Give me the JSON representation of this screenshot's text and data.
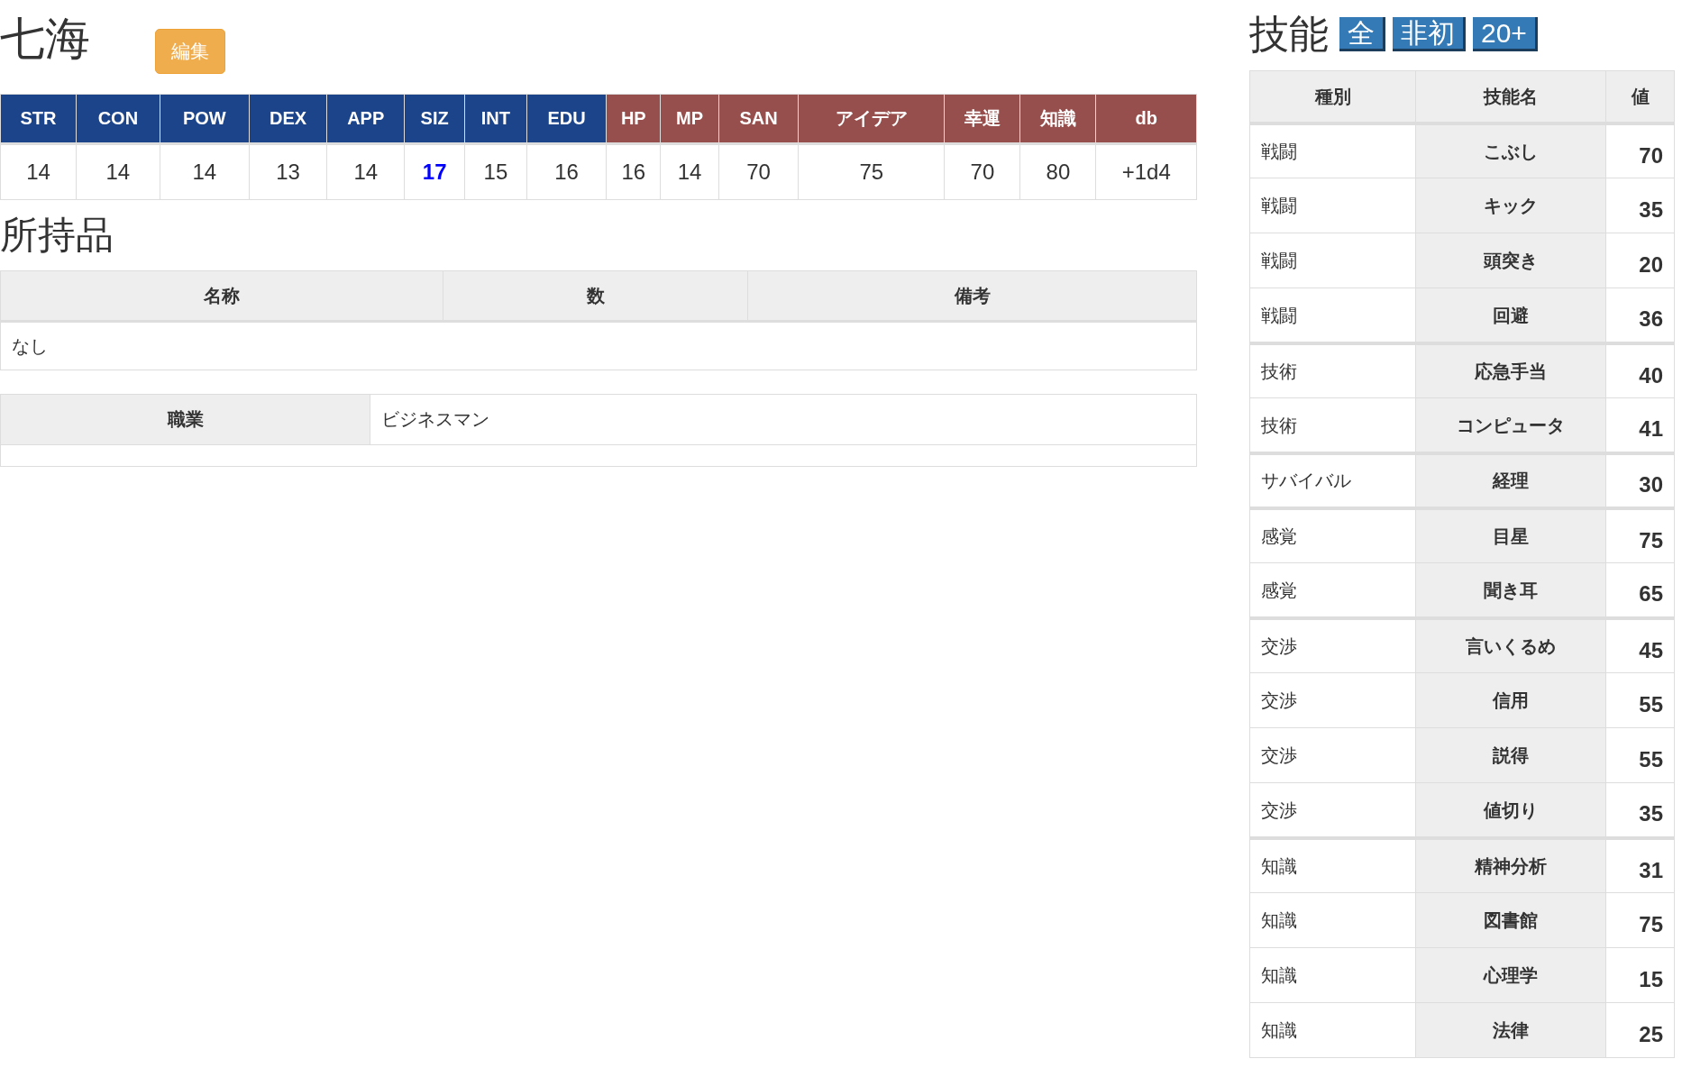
{
  "character": {
    "name": "七海",
    "edit_button": "編集"
  },
  "stats": [
    {
      "label": "STR",
      "value": "14",
      "color": "#1b448b",
      "highlighted": false
    },
    {
      "label": "CON",
      "value": "14",
      "color": "#1b448b",
      "highlighted": false
    },
    {
      "label": "POW",
      "value": "14",
      "color": "#1b448b",
      "highlighted": false
    },
    {
      "label": "DEX",
      "value": "13",
      "color": "#1b448b",
      "highlighted": false
    },
    {
      "label": "APP",
      "value": "14",
      "color": "#1b448b",
      "highlighted": false
    },
    {
      "label": "SIZ",
      "value": "17",
      "color": "#1b448b",
      "highlighted": true
    },
    {
      "label": "INT",
      "value": "15",
      "color": "#1b448b",
      "highlighted": false
    },
    {
      "label": "EDU",
      "value": "16",
      "color": "#1b448b",
      "highlighted": false
    },
    {
      "label": "HP",
      "value": "16",
      "color": "#964f4c",
      "highlighted": false
    },
    {
      "label": "MP",
      "value": "14",
      "color": "#964f4c",
      "highlighted": false
    },
    {
      "label": "SAN",
      "value": "70",
      "color": "#964f4c",
      "highlighted": false
    },
    {
      "label": "アイデア",
      "value": "75",
      "color": "#964f4c",
      "highlighted": false
    },
    {
      "label": "幸運",
      "value": "70",
      "color": "#964f4c",
      "highlighted": false
    },
    {
      "label": "知識",
      "value": "80",
      "color": "#964f4c",
      "highlighted": false
    },
    {
      "label": "db",
      "value": "+1d4",
      "color": "#964f4c",
      "highlighted": false
    }
  ],
  "inventory": {
    "title": "所持品",
    "columns": [
      "名称",
      "数",
      "備考"
    ],
    "empty_text": "なし"
  },
  "profile": {
    "label": "職業",
    "value": "ビジネスマン"
  },
  "skills": {
    "title": "技能",
    "filters": [
      "全",
      "非初",
      "20+"
    ],
    "columns": [
      "種別",
      "技能名",
      "値"
    ],
    "groups": [
      {
        "rows": [
          {
            "category": "戦闘",
            "name": "こぶし",
            "value": "70"
          },
          {
            "category": "戦闘",
            "name": "キック",
            "value": "35"
          },
          {
            "category": "戦闘",
            "name": "頭突き",
            "value": "20"
          },
          {
            "category": "戦闘",
            "name": "回避",
            "value": "36"
          }
        ]
      },
      {
        "rows": [
          {
            "category": "技術",
            "name": "応急手当",
            "value": "40"
          },
          {
            "category": "技術",
            "name": "コンピュータ",
            "value": "41"
          }
        ]
      },
      {
        "rows": [
          {
            "category": "サバイバル",
            "name": "経理",
            "value": "30"
          }
        ]
      },
      {
        "rows": [
          {
            "category": "感覚",
            "name": "目星",
            "value": "75"
          },
          {
            "category": "感覚",
            "name": "聞き耳",
            "value": "65"
          }
        ]
      },
      {
        "rows": [
          {
            "category": "交渉",
            "name": "言いくるめ",
            "value": "45"
          },
          {
            "category": "交渉",
            "name": "信用",
            "value": "55"
          },
          {
            "category": "交渉",
            "name": "説得",
            "value": "55"
          },
          {
            "category": "交渉",
            "name": "値切り",
            "value": "35"
          }
        ]
      },
      {
        "rows": [
          {
            "category": "知識",
            "name": "精神分析",
            "value": "31"
          },
          {
            "category": "知識",
            "name": "図書館",
            "value": "75"
          },
          {
            "category": "知識",
            "name": "心理学",
            "value": "15"
          },
          {
            "category": "知識",
            "name": "法律",
            "value": "25"
          }
        ]
      }
    ]
  }
}
